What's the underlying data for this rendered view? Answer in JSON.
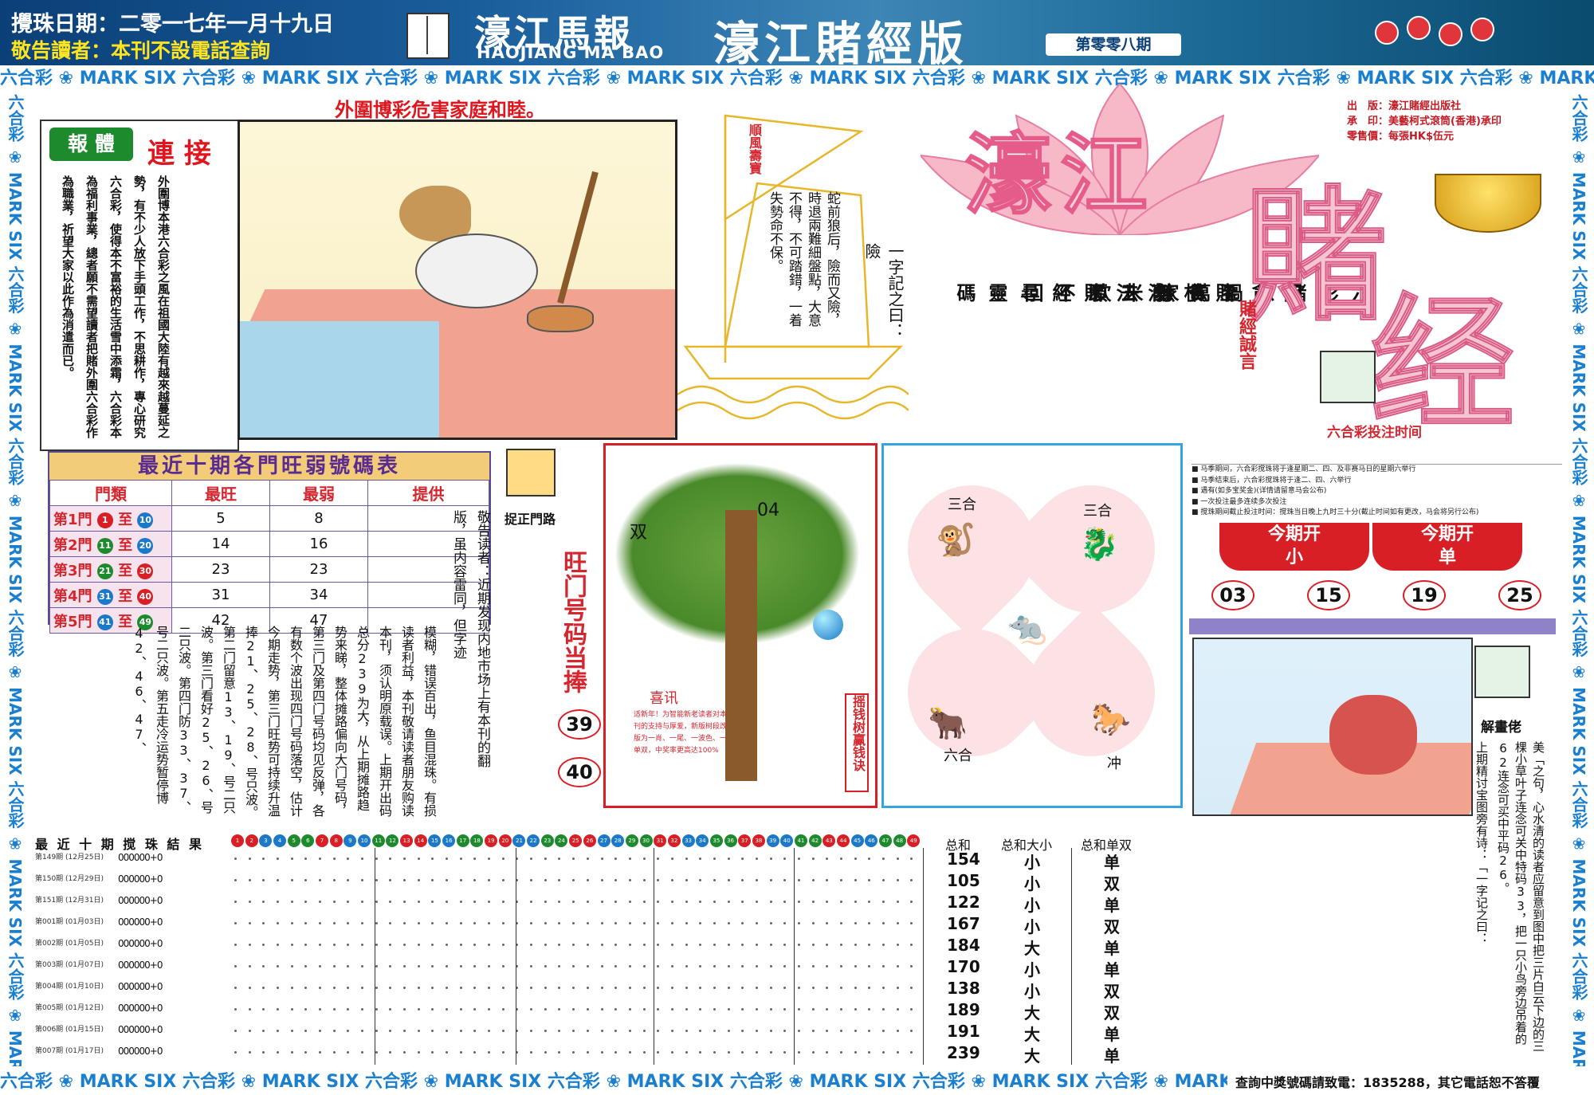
{
  "header": {
    "draw_date": "攪珠日期：二零一七年一月十九日",
    "notice": "敬告讀者：本刊不設電話查詢",
    "logo_cn": "濠江馬報",
    "logo_en": "HAOJIANG MA BAO",
    "edition": "濠江賭經版",
    "issue": "第零零八期"
  },
  "border": {
    "unit": "六合彩 ❀ MARK SIX "
  },
  "headline": "外圍博彩危害家庭和睦。",
  "report": {
    "tag": "報 體",
    "tag2": "連 接",
    "text": "外圍博本港六合彩之風在祖國大陸有越來越蔓延之勢，有不少人放下手頭工作，不思耕作，專心研究六合彩，使得本不富裕的生活雪中添霜，六合彩本為福利事業，總者願不需望讀者把賭外圍六合彩作為職業，祈望大家以此作為消遣而已。"
  },
  "sail": {
    "title": "順風壽寶",
    "proverb": "蛇前狼后，險而又險，時退兩難細盤點，大意不得，不可踏錯，一着失勢命不保。",
    "proverb_head": "一字記之曰：險"
  },
  "poem": [
    "六彩賭患禍萬家",
    "困貪至貧無米炊",
    "賭根削去頭不回",
    "濠江賭經尋靈碼"
  ],
  "big_title": {
    "part1": "濠江",
    "part2": "賭",
    "part3": "经"
  },
  "motto": "賭經誠言",
  "publisher": {
    "line1": "出　版：濠江賭經出版社",
    "line2": "承　印：美藝柯式滾筒(香港)承印",
    "line3": "零售價：每張HK$伍元"
  },
  "bet_time": {
    "title": "六合彩投注时间",
    "lines": [
      "■ 马季期间，六合彩搅珠将于逢星期二、四、及非赛马日的星期六举行",
      "■ 马季结束后，六合彩搅珠将于逢二、四、六举行",
      "■ 遇有(如多宝奖金)(详情请留意马会公布)",
      "■ 一次投注最多连续多次投注",
      "■ 搅珠期间截止投注时间：搅珠当日晚上九时三十分(截止时间如有更改，马会将另行公布)"
    ]
  },
  "this_issue": {
    "tag1_a": "今期开",
    "tag1_b": "小",
    "tag2_a": "今期开",
    "tag2_b": "单",
    "numbers": [
      "03",
      "15",
      "19",
      "25"
    ]
  },
  "ranking": {
    "title": "最近十期各門旺弱號碼表",
    "headers": [
      "門類",
      "最旺",
      "最弱",
      "提供"
    ],
    "rows": [
      {
        "door": "第1門",
        "from": "1",
        "to": "10",
        "max": "5",
        "min": "8",
        "c1": "#d81f26",
        "c2": "#1b79c8"
      },
      {
        "door": "第2門",
        "from": "11",
        "to": "20",
        "max": "14",
        "min": "16",
        "c1": "#1e8a2e",
        "c2": "#1b79c8"
      },
      {
        "door": "第3門",
        "from": "21",
        "to": "30",
        "max": "23",
        "min": "23",
        "c1": "#1e8a2e",
        "c2": "#d81f26"
      },
      {
        "door": "第4門",
        "from": "31",
        "to": "40",
        "max": "31",
        "min": "34",
        "c1": "#1b79c8",
        "c2": "#d81f26"
      },
      {
        "door": "第5門",
        "from": "41",
        "to": "49",
        "max": "42",
        "min": "47",
        "c1": "#1b79c8",
        "c2": "#1e8a2e"
      }
    ],
    "to_word": "至"
  },
  "article": "模糊，错误百出，鱼目混珠。有损读者利益，本刊敬请读者朋友购读本刊，须认明原载误。上期开出码总分239为大，从上期摊路趋势来睇，整体摊路偏向大门号码，第三门及第四门号码均见反弹，各有数个波出现四门号码落空，估计今期走势，第三门旺势可持续升温捧21、25、28、号只波。第二门留意13、19、号二只波。第三门看好25、26、号二只波。第四门防33、37、号二只波。第五走冷运势暂停博42、46、47、",
  "article2": "敬告读者：近期发现内地市场上有本刊的翻版，虽内容雷同，但字迹",
  "door_label": "捉正門路",
  "hot_title": "旺门号码当捧",
  "hot_numbers": [
    "39",
    "40"
  ],
  "tree": {
    "label1": "双",
    "label2": "04",
    "news_title": "喜讯",
    "news_text": "适新年！为智能新老读者对本刊的支持与厚爱，新版树段改版为一肖、一尾、一波色、一单双，中奖率更高达100%",
    "lucky": "摇钱树赢钱诀"
  },
  "zodiac": {
    "l1": "三合",
    "l2": "三合",
    "l3": "六合",
    "l4": "冲",
    "a1": "🐒",
    "a2": "🐉",
    "a3": "🐀",
    "a4": "🐂",
    "a5": "🐎"
  },
  "explain": {
    "label": "解畫佬",
    "text1": "上期精讨宝图旁有诗：「一字记之曰：",
    "text2": "美「之句，心水清的读者应留意到图中把三片白云下边的三棵小草叶子连念可关中特码33，把一只小鸟旁边吊着的62连念可买中平码26。"
  },
  "results": {
    "title": "最 近 十 期 搅 珠 結 果",
    "sum_headers": [
      "总和",
      "总和大小",
      "总和单双"
    ],
    "rows": [
      {
        "label": "第149期 (12月25日)",
        "sum": "154",
        "size": "小",
        "parity": "单"
      },
      {
        "label": "第150期 (12月29日)",
        "sum": "105",
        "size": "小",
        "parity": "双"
      },
      {
        "label": "第151期 (12月31日)",
        "sum": "122",
        "size": "小",
        "parity": "单"
      },
      {
        "label": "第001期 (01月03日)",
        "sum": "167",
        "size": "小",
        "parity": "双"
      },
      {
        "label": "第002期 (01月05日)",
        "sum": "184",
        "size": "大",
        "parity": "单"
      },
      {
        "label": "第003期 (01月07日)",
        "sum": "170",
        "size": "小",
        "parity": "单"
      },
      {
        "label": "第004期 (01月10日)",
        "sum": "138",
        "size": "小",
        "parity": "双"
      },
      {
        "label": "第005期 (01月12日)",
        "sum": "189",
        "size": "大",
        "parity": "双"
      },
      {
        "label": "第006期 (01月15日)",
        "sum": "191",
        "size": "大",
        "parity": "单"
      },
      {
        "label": "第007期 (01月17日)",
        "sum": "239",
        "size": "大",
        "parity": "单"
      }
    ],
    "ball_placeholder": "000000+0"
  },
  "footer_contact": "查詢中獎號碼請致電：1835288，其它電話恕不答覆",
  "colors": {
    "red": "#d81f26",
    "blue": "#1b79c8",
    "green": "#1e8a2e"
  }
}
